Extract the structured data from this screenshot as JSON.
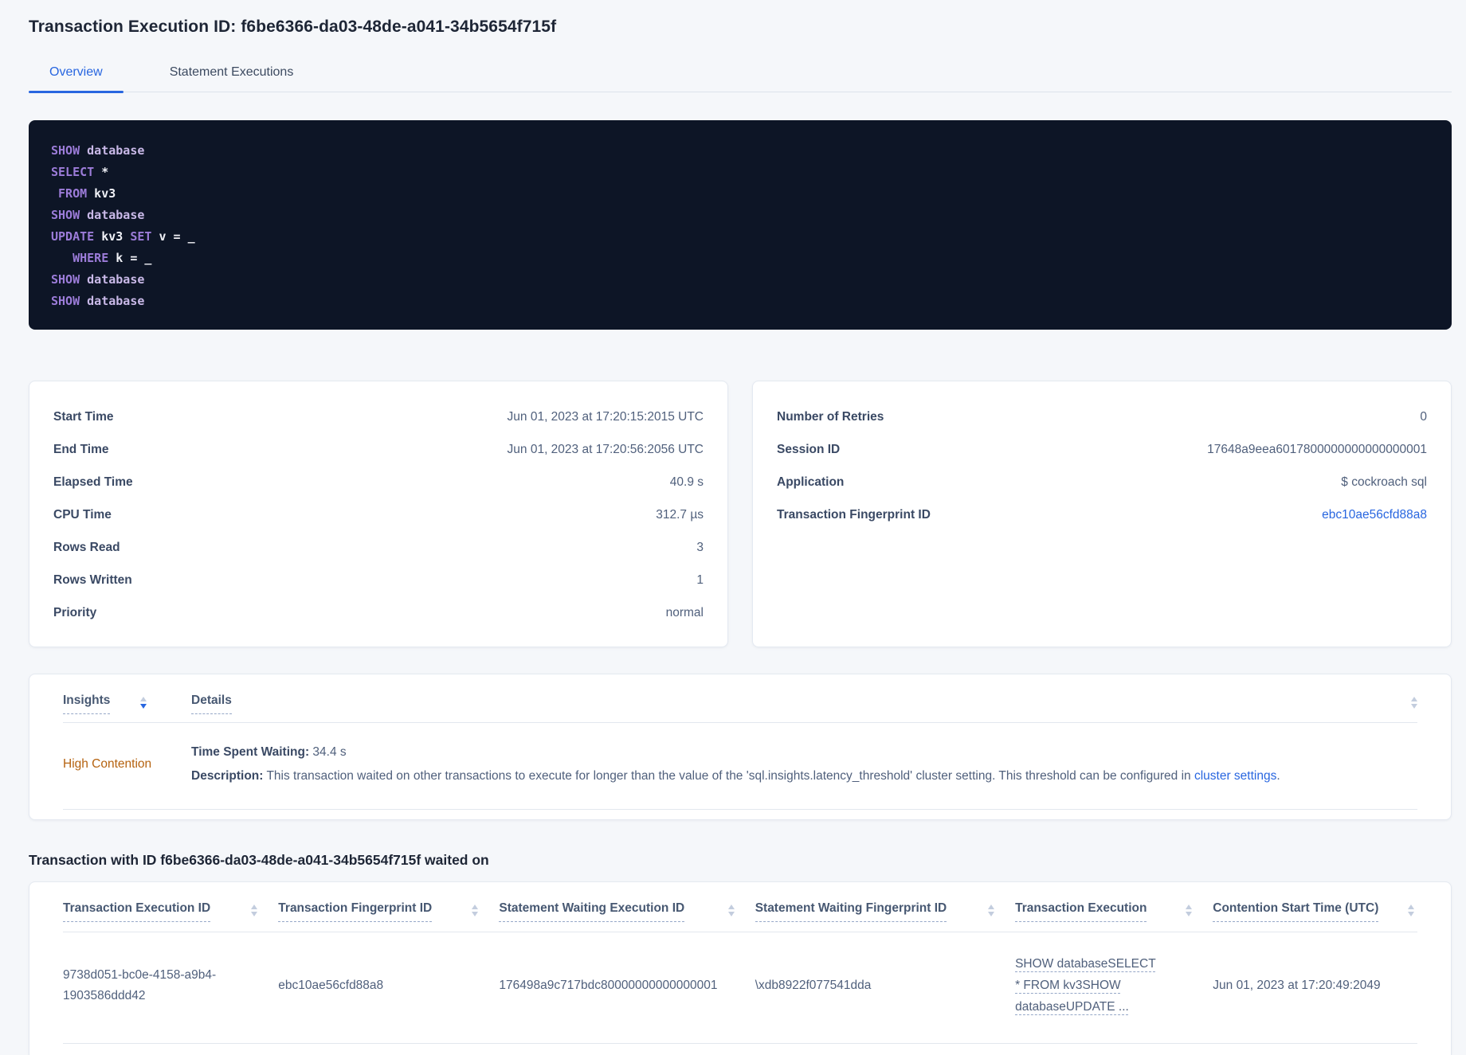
{
  "page_title": "Transaction Execution ID: f6be6366-da03-48de-a041-34b5654f715f",
  "tabs": {
    "overview": "Overview",
    "statement_executions": "Statement Executions"
  },
  "sql_box": {
    "lines": [
      {
        "tokens": [
          {
            "text": "SHOW",
            "type": "kw"
          },
          {
            "text": " database",
            "type": "kw2"
          }
        ]
      },
      {
        "tokens": [
          {
            "text": "SELECT",
            "type": "kw"
          },
          {
            "text": " *",
            "type": "pl"
          }
        ]
      },
      {
        "tokens": [
          {
            "text": " FROM",
            "type": "kw"
          },
          {
            "text": " kv3",
            "type": "pl"
          }
        ]
      },
      {
        "tokens": [
          {
            "text": "SHOW",
            "type": "kw"
          },
          {
            "text": " database",
            "type": "kw2"
          }
        ]
      },
      {
        "tokens": [
          {
            "text": "UPDATE",
            "type": "kw"
          },
          {
            "text": " kv3",
            "type": "pl"
          },
          {
            "text": " SET",
            "type": "kw"
          },
          {
            "text": " v = _",
            "type": "pl"
          }
        ]
      },
      {
        "tokens": [
          {
            "text": "   WHERE",
            "type": "kw"
          },
          {
            "text": " k = _",
            "type": "pl"
          }
        ]
      },
      {
        "tokens": [
          {
            "text": "SHOW",
            "type": "kw"
          },
          {
            "text": " database",
            "type": "kw2"
          }
        ]
      },
      {
        "tokens": [
          {
            "text": "SHOW",
            "type": "kw"
          },
          {
            "text": " database",
            "type": "kw2"
          }
        ]
      }
    ]
  },
  "summary_left": {
    "rows": [
      {
        "label": "Start Time",
        "value": "Jun 01, 2023 at 17:20:15:2015 UTC"
      },
      {
        "label": "End Time",
        "value": "Jun 01, 2023 at 17:20:56:2056 UTC"
      },
      {
        "label": "Elapsed Time",
        "value": "40.9 s"
      },
      {
        "label": "CPU Time",
        "value": "312.7 µs"
      },
      {
        "label": "Rows Read",
        "value": "3"
      },
      {
        "label": "Rows Written",
        "value": "1"
      },
      {
        "label": "Priority",
        "value": "normal"
      }
    ]
  },
  "summary_right": {
    "rows": [
      {
        "label": "Number of Retries",
        "value": "0"
      },
      {
        "label": "Session ID",
        "value": "17648a9eea6017800000000000000001"
      },
      {
        "label": "Application",
        "value": "$ cockroach sql"
      },
      {
        "label": "Transaction Fingerprint ID",
        "value": "ebc10ae56cfd88a8"
      }
    ]
  },
  "insights_table": {
    "headers": {
      "insights": "Insights",
      "details": "Details"
    },
    "row": {
      "insight_label": "High Contention",
      "waiting_label": "Time Spent Waiting:",
      "waiting_value": " 34.4 s",
      "description_label": "Description:",
      "description_text": " This transaction waited on other transactions to execute for longer than the value of the 'sql.insights.latency_threshold' cluster setting. This threshold can be configured in ",
      "description_link": "cluster settings",
      "description_period": "."
    }
  },
  "waited_section": {
    "heading": "Transaction with ID f6be6366-da03-48de-a041-34b5654f715f waited on",
    "columns": [
      "Transaction Execution ID",
      "Transaction Fingerprint ID",
      "Statement Waiting Execution ID",
      "Statement Waiting Fingerprint ID",
      "Transaction Execution",
      "Contention Start Time (UTC)"
    ],
    "row": {
      "transaction_execution_id": "9738d051-bc0e-4158-a9b4-1903586ddd42",
      "transaction_fingerprint_id": "ebc10ae56cfd88a8",
      "statement_waiting_execution_id": "176498a9c717bdc80000000000000001",
      "statement_waiting_fingerprint_id": "\\xdb8922f077541dda",
      "transaction_execution": "SHOW databaseSELECT * FROM kv3SHOW databaseUPDATE ...",
      "contention_start_time": "Jun 01, 2023 at 17:20:49:2049"
    }
  },
  "colors": {
    "accent-blue": "#2866e0",
    "warning-orange": "#b5620f",
    "code-bg": "#0d1526",
    "code-keyword": "#9c7cd9",
    "code-keyword-light": "#c9b9e8",
    "code-plain": "#f0f1f7"
  }
}
